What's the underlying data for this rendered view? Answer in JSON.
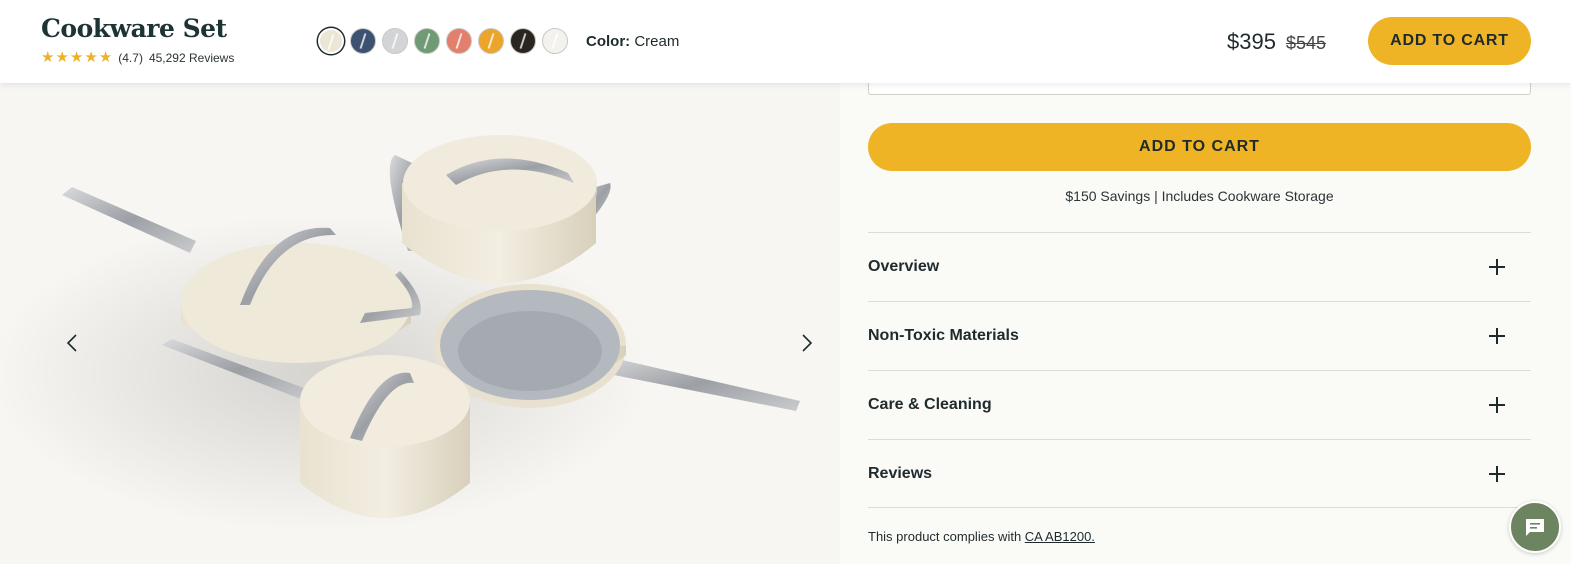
{
  "header": {
    "title": "Cookware Set",
    "rating": "(4.7)",
    "reviews": "45,292 Reviews",
    "star_count": 5,
    "color_label": "Color:",
    "color_value": "Cream",
    "price": "$395",
    "old_price": "$545",
    "cart_label": "ADD TO CART",
    "swatches": [
      {
        "name": "cream",
        "color": "#ece6d6",
        "selected": true
      },
      {
        "name": "navy",
        "color": "#3d5270"
      },
      {
        "name": "gray",
        "color": "#d3d4d6"
      },
      {
        "name": "sage",
        "color": "#6f9a74"
      },
      {
        "name": "terracotta",
        "color": "#e3806d"
      },
      {
        "name": "marigold",
        "color": "#eba52a"
      },
      {
        "name": "black",
        "color": "#2b2520"
      },
      {
        "name": "white",
        "color": "#f4f2ee"
      }
    ]
  },
  "main": {
    "cart_label": "ADD TO CART",
    "savings": "$150 Savings | Includes Cookware Storage",
    "accordion": [
      {
        "label": "Overview"
      },
      {
        "label": "Non-Toxic Materials"
      },
      {
        "label": "Care & Cleaning"
      },
      {
        "label": "Reviews"
      }
    ],
    "compliance_text": "This product complies with",
    "compliance_link": "CA AB1200."
  },
  "colors": {
    "accent": "#efb425",
    "text": "#1f2a2c",
    "star": "#eeb22a",
    "chat": "#6c8560"
  },
  "icons": {
    "prev": "chevron-left-icon",
    "next": "chevron-right-icon",
    "chat": "chat-bubble-icon",
    "expand": "plus-icon"
  }
}
